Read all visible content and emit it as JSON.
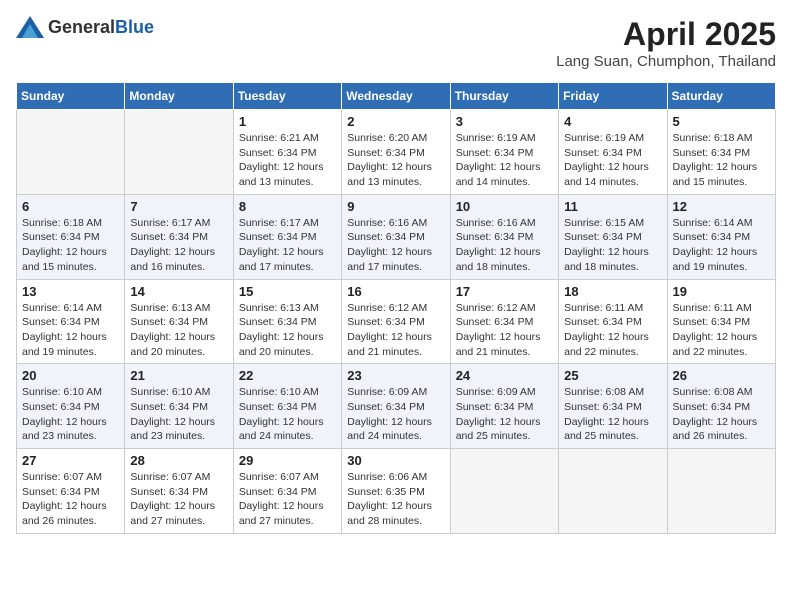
{
  "header": {
    "logo_general": "General",
    "logo_blue": "Blue",
    "month_year": "April 2025",
    "location": "Lang Suan, Chumphon, Thailand"
  },
  "weekdays": [
    "Sunday",
    "Monday",
    "Tuesday",
    "Wednesday",
    "Thursday",
    "Friday",
    "Saturday"
  ],
  "weeks": [
    [
      {
        "day": "",
        "info": ""
      },
      {
        "day": "",
        "info": ""
      },
      {
        "day": "1",
        "info": "Sunrise: 6:21 AM\nSunset: 6:34 PM\nDaylight: 12 hours and 13 minutes."
      },
      {
        "day": "2",
        "info": "Sunrise: 6:20 AM\nSunset: 6:34 PM\nDaylight: 12 hours and 13 minutes."
      },
      {
        "day": "3",
        "info": "Sunrise: 6:19 AM\nSunset: 6:34 PM\nDaylight: 12 hours and 14 minutes."
      },
      {
        "day": "4",
        "info": "Sunrise: 6:19 AM\nSunset: 6:34 PM\nDaylight: 12 hours and 14 minutes."
      },
      {
        "day": "5",
        "info": "Sunrise: 6:18 AM\nSunset: 6:34 PM\nDaylight: 12 hours and 15 minutes."
      }
    ],
    [
      {
        "day": "6",
        "info": "Sunrise: 6:18 AM\nSunset: 6:34 PM\nDaylight: 12 hours and 15 minutes."
      },
      {
        "day": "7",
        "info": "Sunrise: 6:17 AM\nSunset: 6:34 PM\nDaylight: 12 hours and 16 minutes."
      },
      {
        "day": "8",
        "info": "Sunrise: 6:17 AM\nSunset: 6:34 PM\nDaylight: 12 hours and 17 minutes."
      },
      {
        "day": "9",
        "info": "Sunrise: 6:16 AM\nSunset: 6:34 PM\nDaylight: 12 hours and 17 minutes."
      },
      {
        "day": "10",
        "info": "Sunrise: 6:16 AM\nSunset: 6:34 PM\nDaylight: 12 hours and 18 minutes."
      },
      {
        "day": "11",
        "info": "Sunrise: 6:15 AM\nSunset: 6:34 PM\nDaylight: 12 hours and 18 minutes."
      },
      {
        "day": "12",
        "info": "Sunrise: 6:14 AM\nSunset: 6:34 PM\nDaylight: 12 hours and 19 minutes."
      }
    ],
    [
      {
        "day": "13",
        "info": "Sunrise: 6:14 AM\nSunset: 6:34 PM\nDaylight: 12 hours and 19 minutes."
      },
      {
        "day": "14",
        "info": "Sunrise: 6:13 AM\nSunset: 6:34 PM\nDaylight: 12 hours and 20 minutes."
      },
      {
        "day": "15",
        "info": "Sunrise: 6:13 AM\nSunset: 6:34 PM\nDaylight: 12 hours and 20 minutes."
      },
      {
        "day": "16",
        "info": "Sunrise: 6:12 AM\nSunset: 6:34 PM\nDaylight: 12 hours and 21 minutes."
      },
      {
        "day": "17",
        "info": "Sunrise: 6:12 AM\nSunset: 6:34 PM\nDaylight: 12 hours and 21 minutes."
      },
      {
        "day": "18",
        "info": "Sunrise: 6:11 AM\nSunset: 6:34 PM\nDaylight: 12 hours and 22 minutes."
      },
      {
        "day": "19",
        "info": "Sunrise: 6:11 AM\nSunset: 6:34 PM\nDaylight: 12 hours and 22 minutes."
      }
    ],
    [
      {
        "day": "20",
        "info": "Sunrise: 6:10 AM\nSunset: 6:34 PM\nDaylight: 12 hours and 23 minutes."
      },
      {
        "day": "21",
        "info": "Sunrise: 6:10 AM\nSunset: 6:34 PM\nDaylight: 12 hours and 23 minutes."
      },
      {
        "day": "22",
        "info": "Sunrise: 6:10 AM\nSunset: 6:34 PM\nDaylight: 12 hours and 24 minutes."
      },
      {
        "day": "23",
        "info": "Sunrise: 6:09 AM\nSunset: 6:34 PM\nDaylight: 12 hours and 24 minutes."
      },
      {
        "day": "24",
        "info": "Sunrise: 6:09 AM\nSunset: 6:34 PM\nDaylight: 12 hours and 25 minutes."
      },
      {
        "day": "25",
        "info": "Sunrise: 6:08 AM\nSunset: 6:34 PM\nDaylight: 12 hours and 25 minutes."
      },
      {
        "day": "26",
        "info": "Sunrise: 6:08 AM\nSunset: 6:34 PM\nDaylight: 12 hours and 26 minutes."
      }
    ],
    [
      {
        "day": "27",
        "info": "Sunrise: 6:07 AM\nSunset: 6:34 PM\nDaylight: 12 hours and 26 minutes."
      },
      {
        "day": "28",
        "info": "Sunrise: 6:07 AM\nSunset: 6:34 PM\nDaylight: 12 hours and 27 minutes."
      },
      {
        "day": "29",
        "info": "Sunrise: 6:07 AM\nSunset: 6:34 PM\nDaylight: 12 hours and 27 minutes."
      },
      {
        "day": "30",
        "info": "Sunrise: 6:06 AM\nSunset: 6:35 PM\nDaylight: 12 hours and 28 minutes."
      },
      {
        "day": "",
        "info": ""
      },
      {
        "day": "",
        "info": ""
      },
      {
        "day": "",
        "info": ""
      }
    ]
  ]
}
